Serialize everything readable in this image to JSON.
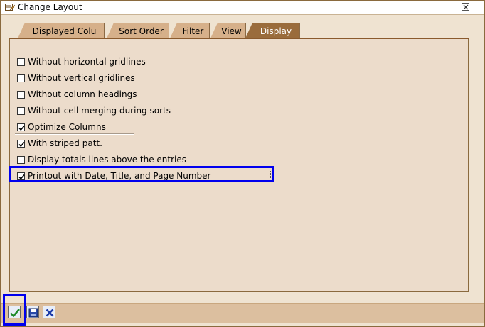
{
  "window": {
    "title": "Change Layout"
  },
  "tabs": [
    {
      "label": "Displayed Colu",
      "active": false
    },
    {
      "label": "Sort Order",
      "active": false
    },
    {
      "label": "Filter",
      "active": false
    },
    {
      "label": "View",
      "active": false
    },
    {
      "label": "Display",
      "active": true
    }
  ],
  "options": [
    {
      "label": "Without horizontal gridlines",
      "checked": false
    },
    {
      "label": "Without vertical gridlines",
      "checked": false
    },
    {
      "label": "Without column headings",
      "checked": false
    },
    {
      "label": "Without cell merging during sorts",
      "checked": false
    },
    {
      "label": "Optimize Columns",
      "checked": true
    },
    {
      "label": "With striped patt.",
      "checked": true
    },
    {
      "label": "Display totals lines above the entries",
      "checked": false
    },
    {
      "label": "Printout with Date, Title, and Page Number",
      "checked": true
    }
  ],
  "buttons": {
    "ok": "check-icon",
    "save": "save-icon",
    "cancel": "cancel-icon"
  },
  "colors": {
    "highlight": "#0000ee",
    "active_tab": "#9a6c3c",
    "inactive_tab": "#d6b08a",
    "panel": "#ecdccb"
  }
}
